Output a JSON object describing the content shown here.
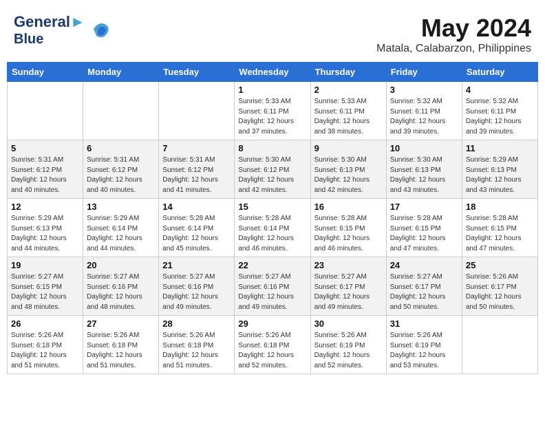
{
  "header": {
    "logo_line1": "General",
    "logo_line2": "Blue",
    "month": "May 2024",
    "location": "Matala, Calabarzon, Philippines"
  },
  "weekdays": [
    "Sunday",
    "Monday",
    "Tuesday",
    "Wednesday",
    "Thursday",
    "Friday",
    "Saturday"
  ],
  "weeks": [
    [
      {
        "day": "",
        "sunrise": "",
        "sunset": "",
        "daylight": ""
      },
      {
        "day": "",
        "sunrise": "",
        "sunset": "",
        "daylight": ""
      },
      {
        "day": "",
        "sunrise": "",
        "sunset": "",
        "daylight": ""
      },
      {
        "day": "1",
        "sunrise": "Sunrise: 5:33 AM",
        "sunset": "Sunset: 6:11 PM",
        "daylight": "Daylight: 12 hours and 37 minutes."
      },
      {
        "day": "2",
        "sunrise": "Sunrise: 5:33 AM",
        "sunset": "Sunset: 6:11 PM",
        "daylight": "Daylight: 12 hours and 38 minutes."
      },
      {
        "day": "3",
        "sunrise": "Sunrise: 5:32 AM",
        "sunset": "Sunset: 6:11 PM",
        "daylight": "Daylight: 12 hours and 39 minutes."
      },
      {
        "day": "4",
        "sunrise": "Sunrise: 5:32 AM",
        "sunset": "Sunset: 6:11 PM",
        "daylight": "Daylight: 12 hours and 39 minutes."
      }
    ],
    [
      {
        "day": "5",
        "sunrise": "Sunrise: 5:31 AM",
        "sunset": "Sunset: 6:12 PM",
        "daylight": "Daylight: 12 hours and 40 minutes."
      },
      {
        "day": "6",
        "sunrise": "Sunrise: 5:31 AM",
        "sunset": "Sunset: 6:12 PM",
        "daylight": "Daylight: 12 hours and 40 minutes."
      },
      {
        "day": "7",
        "sunrise": "Sunrise: 5:31 AM",
        "sunset": "Sunset: 6:12 PM",
        "daylight": "Daylight: 12 hours and 41 minutes."
      },
      {
        "day": "8",
        "sunrise": "Sunrise: 5:30 AM",
        "sunset": "Sunset: 6:12 PM",
        "daylight": "Daylight: 12 hours and 42 minutes."
      },
      {
        "day": "9",
        "sunrise": "Sunrise: 5:30 AM",
        "sunset": "Sunset: 6:13 PM",
        "daylight": "Daylight: 12 hours and 42 minutes."
      },
      {
        "day": "10",
        "sunrise": "Sunrise: 5:30 AM",
        "sunset": "Sunset: 6:13 PM",
        "daylight": "Daylight: 12 hours and 43 minutes."
      },
      {
        "day": "11",
        "sunrise": "Sunrise: 5:29 AM",
        "sunset": "Sunset: 6:13 PM",
        "daylight": "Daylight: 12 hours and 43 minutes."
      }
    ],
    [
      {
        "day": "12",
        "sunrise": "Sunrise: 5:29 AM",
        "sunset": "Sunset: 6:13 PM",
        "daylight": "Daylight: 12 hours and 44 minutes."
      },
      {
        "day": "13",
        "sunrise": "Sunrise: 5:29 AM",
        "sunset": "Sunset: 6:14 PM",
        "daylight": "Daylight: 12 hours and 44 minutes."
      },
      {
        "day": "14",
        "sunrise": "Sunrise: 5:28 AM",
        "sunset": "Sunset: 6:14 PM",
        "daylight": "Daylight: 12 hours and 45 minutes."
      },
      {
        "day": "15",
        "sunrise": "Sunrise: 5:28 AM",
        "sunset": "Sunset: 6:14 PM",
        "daylight": "Daylight: 12 hours and 46 minutes."
      },
      {
        "day": "16",
        "sunrise": "Sunrise: 5:28 AM",
        "sunset": "Sunset: 6:15 PM",
        "daylight": "Daylight: 12 hours and 46 minutes."
      },
      {
        "day": "17",
        "sunrise": "Sunrise: 5:28 AM",
        "sunset": "Sunset: 6:15 PM",
        "daylight": "Daylight: 12 hours and 47 minutes."
      },
      {
        "day": "18",
        "sunrise": "Sunrise: 5:28 AM",
        "sunset": "Sunset: 6:15 PM",
        "daylight": "Daylight: 12 hours and 47 minutes."
      }
    ],
    [
      {
        "day": "19",
        "sunrise": "Sunrise: 5:27 AM",
        "sunset": "Sunset: 6:15 PM",
        "daylight": "Daylight: 12 hours and 48 minutes."
      },
      {
        "day": "20",
        "sunrise": "Sunrise: 5:27 AM",
        "sunset": "Sunset: 6:16 PM",
        "daylight": "Daylight: 12 hours and 48 minutes."
      },
      {
        "day": "21",
        "sunrise": "Sunrise: 5:27 AM",
        "sunset": "Sunset: 6:16 PM",
        "daylight": "Daylight: 12 hours and 49 minutes."
      },
      {
        "day": "22",
        "sunrise": "Sunrise: 5:27 AM",
        "sunset": "Sunset: 6:16 PM",
        "daylight": "Daylight: 12 hours and 49 minutes."
      },
      {
        "day": "23",
        "sunrise": "Sunrise: 5:27 AM",
        "sunset": "Sunset: 6:17 PM",
        "daylight": "Daylight: 12 hours and 49 minutes."
      },
      {
        "day": "24",
        "sunrise": "Sunrise: 5:27 AM",
        "sunset": "Sunset: 6:17 PM",
        "daylight": "Daylight: 12 hours and 50 minutes."
      },
      {
        "day": "25",
        "sunrise": "Sunrise: 5:26 AM",
        "sunset": "Sunset: 6:17 PM",
        "daylight": "Daylight: 12 hours and 50 minutes."
      }
    ],
    [
      {
        "day": "26",
        "sunrise": "Sunrise: 5:26 AM",
        "sunset": "Sunset: 6:18 PM",
        "daylight": "Daylight: 12 hours and 51 minutes."
      },
      {
        "day": "27",
        "sunrise": "Sunrise: 5:26 AM",
        "sunset": "Sunset: 6:18 PM",
        "daylight": "Daylight: 12 hours and 51 minutes."
      },
      {
        "day": "28",
        "sunrise": "Sunrise: 5:26 AM",
        "sunset": "Sunset: 6:18 PM",
        "daylight": "Daylight: 12 hours and 51 minutes."
      },
      {
        "day": "29",
        "sunrise": "Sunrise: 5:26 AM",
        "sunset": "Sunset: 6:18 PM",
        "daylight": "Daylight: 12 hours and 52 minutes."
      },
      {
        "day": "30",
        "sunrise": "Sunrise: 5:26 AM",
        "sunset": "Sunset: 6:19 PM",
        "daylight": "Daylight: 12 hours and 52 minutes."
      },
      {
        "day": "31",
        "sunrise": "Sunrise: 5:26 AM",
        "sunset": "Sunset: 6:19 PM",
        "daylight": "Daylight: 12 hours and 53 minutes."
      },
      {
        "day": "",
        "sunrise": "",
        "sunset": "",
        "daylight": ""
      }
    ]
  ]
}
